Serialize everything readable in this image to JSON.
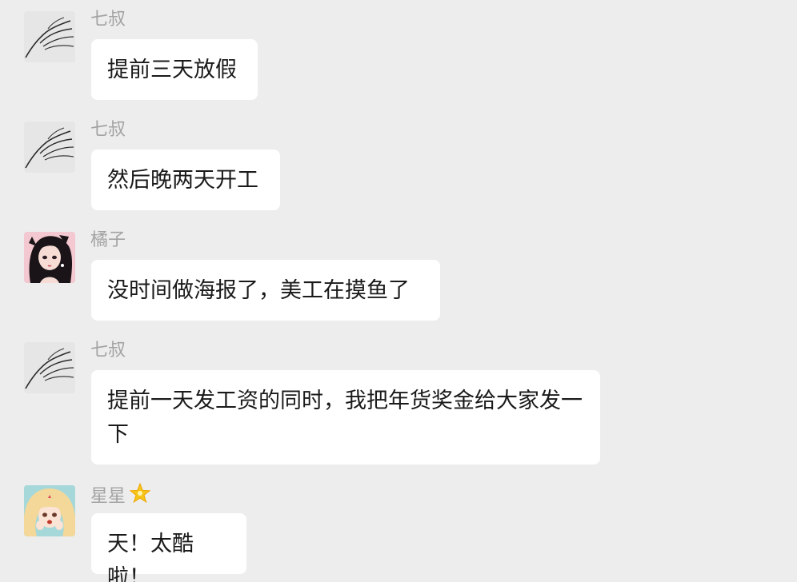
{
  "messages": [
    {
      "sender": "七叔",
      "avatar": "hand-avatar",
      "text": "提前三天放假"
    },
    {
      "sender": "七叔",
      "avatar": "hand-avatar",
      "text": "然后晚两天开工"
    },
    {
      "sender": "橘子",
      "avatar": "anime-girl-black-hair-avatar",
      "text": "没时间做海报了，美工在摸鱼了"
    },
    {
      "sender": "七叔",
      "avatar": "hand-avatar",
      "text": "提前一天发工资的同时，我把年货奖金给大家发一下"
    },
    {
      "sender": "星星",
      "sender_emoji": "glowing-star-icon",
      "avatar": "anime-girl-blonde-avatar",
      "text": "天！太酷啦！"
    }
  ]
}
